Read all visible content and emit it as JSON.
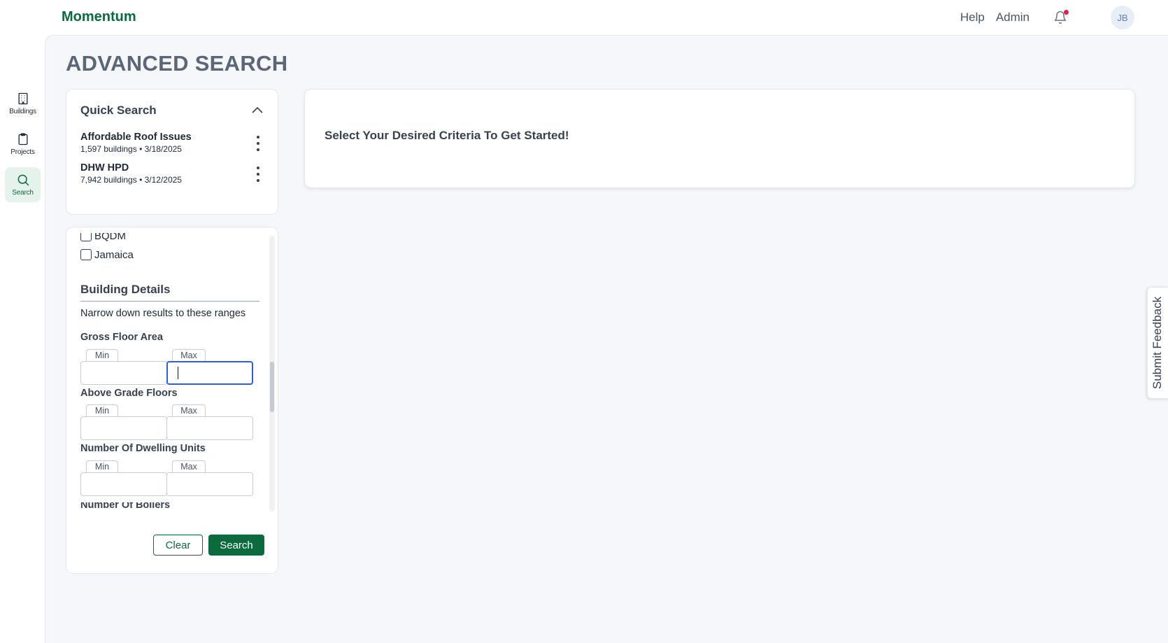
{
  "app": {
    "brand": "Momentum"
  },
  "header": {
    "links": [
      "Help",
      "Admin"
    ],
    "avatar_initials": "JB",
    "notification_dot_color": "#e11d48"
  },
  "rail": {
    "items": [
      {
        "label": "Buildings",
        "icon": "building-icon",
        "active": false
      },
      {
        "label": "Projects",
        "icon": "clipboard-icon",
        "active": false
      },
      {
        "label": "Search",
        "icon": "search-icon",
        "active": true
      }
    ]
  },
  "page": {
    "title": "ADVANCED SEARCH"
  },
  "quick_search": {
    "title": "Quick Search",
    "items": [
      {
        "name": "Affordable Roof Issues",
        "meta": "1,597 buildings • 3/18/2025"
      },
      {
        "name": "DHW HPD",
        "meta": "7,942 buildings • 3/12/2025"
      }
    ]
  },
  "filters": {
    "checkboxes": [
      {
        "label": "BQDM",
        "checked": false
      },
      {
        "label": "Jamaica",
        "checked": false
      }
    ],
    "building_details": {
      "title": "Building Details",
      "description": "Narrow down results to these ranges",
      "min_label": "Min",
      "max_label": "Max",
      "ranges": [
        {
          "label": "Gross Floor Area",
          "min": "",
          "max": ""
        },
        {
          "label": "Above Grade Floors",
          "min": "",
          "max": ""
        },
        {
          "label": "Number Of Dwelling Units",
          "min": "",
          "max": ""
        },
        {
          "label": "Number Of Boilers"
        }
      ]
    },
    "buttons": {
      "clear": "Clear",
      "search": "Search"
    }
  },
  "results": {
    "message": "Select Your Desired Criteria To Get Started!"
  },
  "feedback": {
    "label": "Submit Feedback"
  },
  "colors": {
    "brand_green": "#0b6b3f",
    "focus_blue": "#2f5fd6",
    "page_bg": "#f6f7fb"
  }
}
